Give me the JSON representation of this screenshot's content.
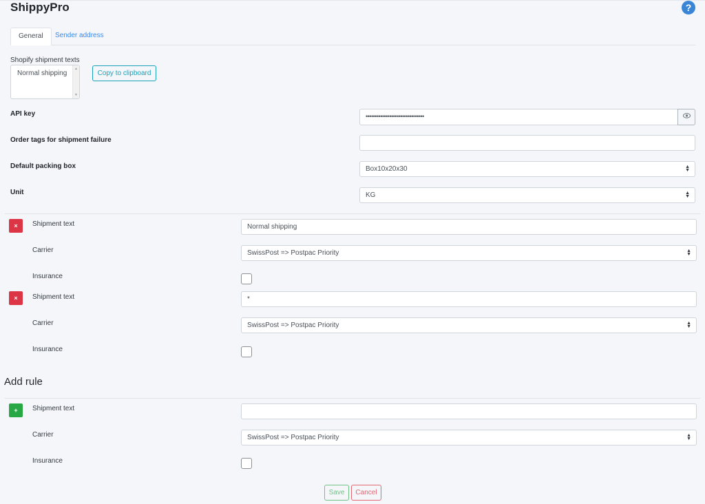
{
  "app": {
    "title": "ShippyPro",
    "help_icon": "?"
  },
  "tabs": [
    {
      "label": "General",
      "active": true
    },
    {
      "label": "Sender address",
      "active": false
    }
  ],
  "shipment_texts": {
    "label": "Shopify shipment texts",
    "values": [
      "Normal shipping"
    ],
    "copy_button": "Copy to clipboard"
  },
  "settings": {
    "api_key": {
      "label": "API key",
      "value": "••••••••••••••••••••••••••••••••",
      "toggle_icon": "eye-icon"
    },
    "order_tags": {
      "label": "Order tags for shipment failure",
      "value": ""
    },
    "packing_box": {
      "label": "Default packing box",
      "value": "Box10x20x30"
    },
    "unit": {
      "label": "Unit",
      "value": "KG"
    }
  },
  "rules": [
    {
      "shipment_text_label": "Shipment text",
      "shipment_text_value": "Normal shipping",
      "carrier_label": "Carrier",
      "carrier_value": "SwissPost => Postpac Priority",
      "insurance_label": "Insurance",
      "insurance_checked": false,
      "delete_icon": "×"
    },
    {
      "shipment_text_label": "Shipment text",
      "shipment_text_value": "*",
      "carrier_label": "Carrier",
      "carrier_value": "SwissPost => Postpac Priority",
      "insurance_label": "Insurance",
      "insurance_checked": false,
      "delete_icon": "×"
    }
  ],
  "add_rule": {
    "heading": "Add rule",
    "shipment_text_label": "Shipment text",
    "shipment_text_value": "",
    "carrier_label": "Carrier",
    "carrier_value": "SwissPost => Postpac Priority",
    "insurance_label": "Insurance",
    "insurance_checked": false,
    "add_icon": "+"
  },
  "actions": {
    "save": "Save",
    "cancel": "Cancel"
  }
}
